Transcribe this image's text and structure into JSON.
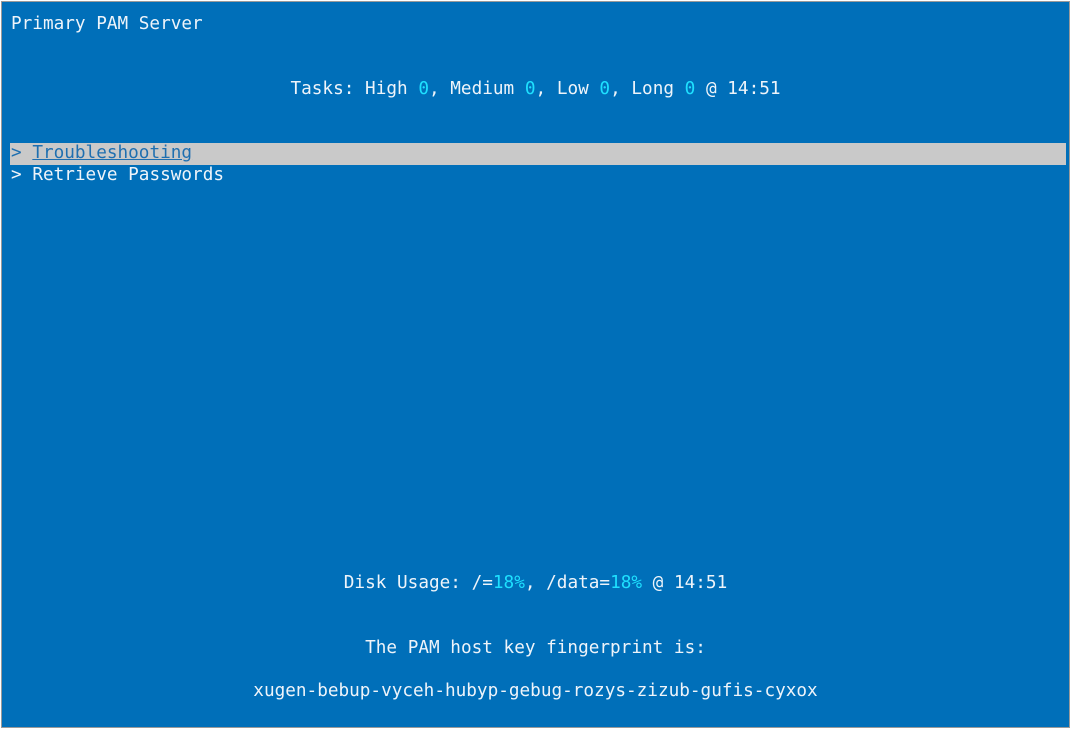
{
  "title": "Primary PAM Server",
  "tasks": {
    "label": "Tasks:",
    "high_label": "High",
    "high": "0",
    "medium_label": "Medium",
    "medium": "0",
    "low_label": "Low",
    "low": "0",
    "long_label": "Long",
    "long": "0",
    "time": "14:51"
  },
  "menu": {
    "items": [
      {
        "label": "Troubleshooting",
        "selected": true
      },
      {
        "label": "Retrieve Passwords",
        "selected": false
      }
    ],
    "chevron": ">"
  },
  "disk": {
    "label": "Disk Usage:",
    "root_label": "/=",
    "root": "18%",
    "data_label": "/data=",
    "data": "18%",
    "time": "14:51"
  },
  "fingerprint": {
    "label": "The PAM host key fingerprint is:",
    "value": "xugen-bebup-vyceh-hubyp-gebug-rozys-zizub-gufis-cyxox"
  },
  "colors": {
    "background": "#006fb9",
    "highlight": "#1ee0ff",
    "selection": "#c9c9c9"
  }
}
